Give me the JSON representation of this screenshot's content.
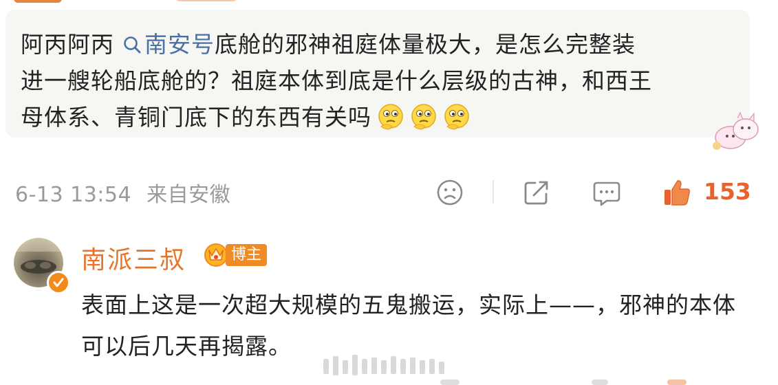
{
  "quote": {
    "author": "阿丙阿丙",
    "topic": "南安号",
    "text_line1_rest": "底舱的邪神祖庭体量极大，是怎么完整装",
    "text_line2": "进一艘轮船底舱的？祖庭本体到底是什么层级的古神，和西王",
    "text_line3": "母体系、青铜门底下的东西有关吗"
  },
  "meta": {
    "timestamp": "6-13 13:54",
    "source": "来自安徽"
  },
  "actions": {
    "like_count": "153"
  },
  "reply": {
    "username": "南派三叔",
    "tag": "博主",
    "text": "表面上这是一次超大规模的五鬼搬运，实际上——，邪神的本体可以后几天再揭露。"
  },
  "icons": {
    "topic": "search-icon",
    "emoji": "thinking-face-icon",
    "sticker": "cat-sticker-icon",
    "dislike": "frown-face-icon",
    "share": "share-icon",
    "comment": "comment-icon",
    "like": "thumbs-up-icon",
    "crown": "crown-icon",
    "verify": "verified-badge-icon"
  },
  "colors": {
    "username": "#e8742b",
    "like": "#e8612e",
    "topic": "#4a6fa5",
    "meta": "#9a9a9a",
    "quote_bg": "#f6f6f3"
  }
}
